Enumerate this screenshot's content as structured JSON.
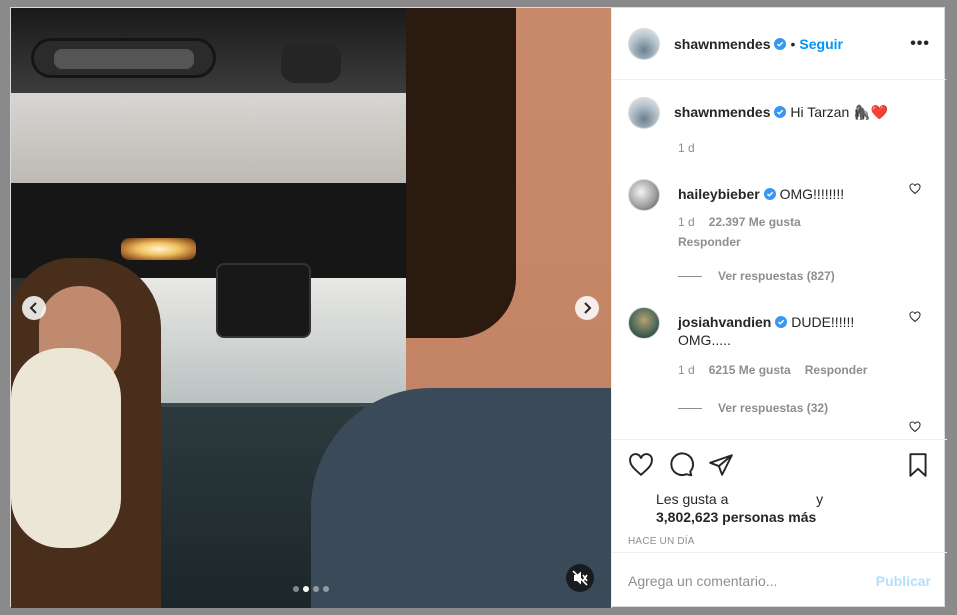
{
  "post": {
    "author": "shawnmendes",
    "follow_label": "Seguir",
    "separator": "•",
    "more_label": "•••",
    "slide_count": 4,
    "active_slide": 1
  },
  "caption": {
    "user": "shawnmendes",
    "text": "Hi Tarzan 🦍❤️",
    "time": "1 d"
  },
  "comments": [
    {
      "user": "haileybieber",
      "text": "OMG!!!!!!!!",
      "time": "1 d",
      "likes": "22.397 Me gusta",
      "reply_label": "Responder",
      "view_replies": "Ver respuestas (827)"
    },
    {
      "user": "josiahvandien",
      "text": "DUDE!!!!!!\nOMG.....",
      "time": "1 d",
      "likes": "6215 Me gusta",
      "reply_label": "Responder",
      "view_replies": "Ver respuestas (32)"
    }
  ],
  "likes_line1": "Les gusta a",
  "likes_and": "y",
  "likes_line2": "3,802,623 personas más",
  "date_label": "HACE UN DÍA",
  "composer": {
    "placeholder": "Agrega un comentario...",
    "submit_label": "Publicar"
  },
  "icons": {
    "verified": "verified-badge-icon",
    "like": "heart-icon",
    "comment": "comment-icon",
    "share": "paper-plane-icon",
    "save": "bookmark-icon",
    "mute": "speaker-muted-icon"
  },
  "colors": {
    "link": "#0095f6",
    "publish_disabled": "#b2dffc",
    "muted_text": "#8e8e8e",
    "backdrop": "#8a8a8a"
  }
}
